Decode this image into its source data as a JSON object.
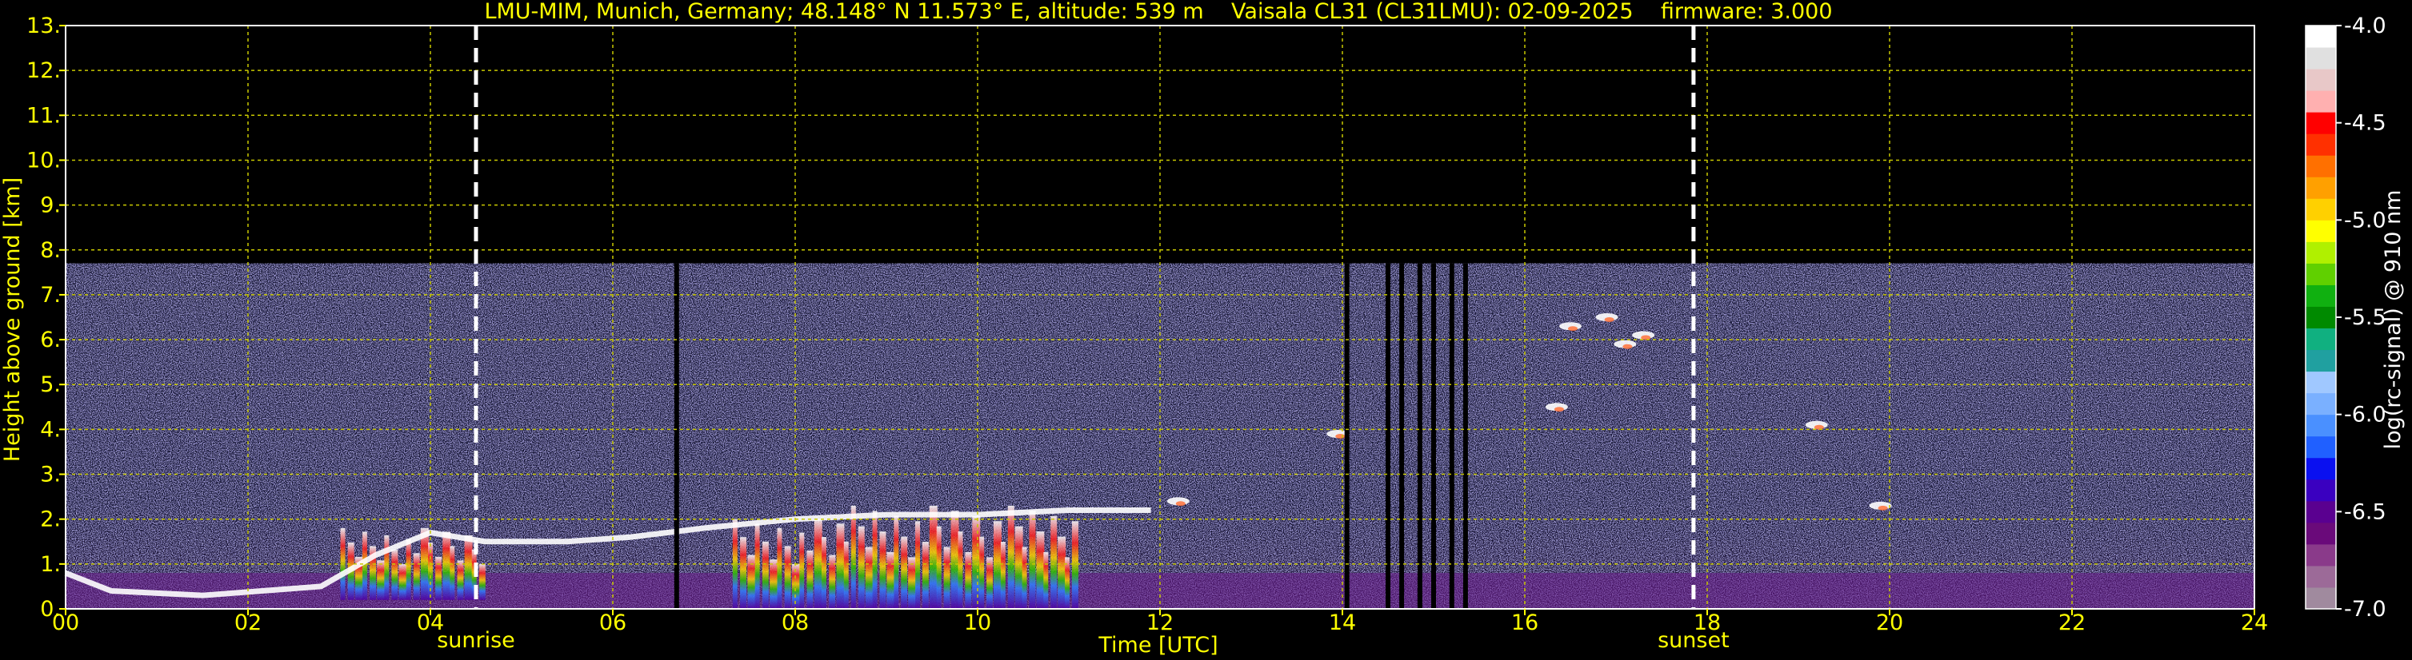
{
  "chart_data": {
    "type": "heatmap",
    "title": "LMU-MIM, Munich, Germany; 48.148° N 11.573° E, altitude: 539 m    Vaisala CL31 (CL31LMU): 02-09-2025    firmware: 3.000",
    "xlabel": "Time [UTC]",
    "ylabel": "Height above ground [km]",
    "xlim": [
      0,
      24
    ],
    "ylim": [
      0,
      13
    ],
    "x_ticks": [
      "00",
      "02",
      "04",
      "06",
      "08",
      "10",
      "12",
      "14",
      "16",
      "18",
      "20",
      "22",
      "24"
    ],
    "y_ticks": [
      "0.",
      "1.",
      "2.",
      "3.",
      "4.",
      "5.",
      "6.",
      "7.",
      "8.",
      "9.",
      "10.",
      "11.",
      "12.",
      "13."
    ],
    "grid": true,
    "grid_color": "#c8c800",
    "colorbar": {
      "label": "log(rc-signal) @ 910 nm",
      "range": [
        -7.0,
        -4.0
      ],
      "ticks": [
        "-7.0",
        "-6.5",
        "-6.0",
        "-5.5",
        "-5.0",
        "-4.5",
        "-4.0"
      ],
      "colors": [
        "#a08a9e",
        "#9c6a98",
        "#8a3a8a",
        "#6a0a7a",
        "#5a0090",
        "#3a00c0",
        "#0a10f0",
        "#2060ff",
        "#4a90ff",
        "#7ab0ff",
        "#a0c8ff",
        "#20a0a0",
        "#10b080",
        "#008a00",
        "#10b010",
        "#60d000",
        "#b0f000",
        "#ffff00",
        "#ffd000",
        "#ffa000",
        "#ff7000",
        "#ff3000",
        "#ff0000",
        "#ffb0b0",
        "#e8c8c8",
        "#e0e0e0",
        "#ffffff"
      ]
    },
    "annotations": [
      {
        "label": "sunrise",
        "x": 4.5
      },
      {
        "label": "sunset",
        "x": 17.85
      }
    ],
    "signal_top_km": 7.7,
    "cloud_layer": [
      {
        "x": 0.0,
        "y": 0.8
      },
      {
        "x": 0.5,
        "y": 0.4
      },
      {
        "x": 1.5,
        "y": 0.3
      },
      {
        "x": 2.8,
        "y": 0.5
      },
      {
        "x": 3.4,
        "y": 1.2
      },
      {
        "x": 4.0,
        "y": 1.7
      },
      {
        "x": 4.6,
        "y": 1.5
      },
      {
        "x": 5.5,
        "y": 1.5
      },
      {
        "x": 6.2,
        "y": 1.6
      },
      {
        "x": 7.0,
        "y": 1.8
      },
      {
        "x": 8.0,
        "y": 2.0
      },
      {
        "x": 9.0,
        "y": 2.1
      },
      {
        "x": 10.0,
        "y": 2.1
      },
      {
        "x": 11.0,
        "y": 2.2
      },
      {
        "x": 11.9,
        "y": 2.2
      }
    ],
    "aerosol_bursts": [
      {
        "x0": 3.0,
        "x1": 4.6,
        "y0": 0.2,
        "y1": 1.8
      },
      {
        "x0": 7.3,
        "x1": 8.6,
        "y0": 0.0,
        "y1": 2.0
      },
      {
        "x0": 8.6,
        "x1": 11.1,
        "y0": 0.0,
        "y1": 2.3
      }
    ],
    "clouds_high": [
      {
        "x": 13.95,
        "y": 3.9
      },
      {
        "x": 16.35,
        "y": 4.5
      },
      {
        "x": 16.5,
        "y": 6.3
      },
      {
        "x": 16.9,
        "y": 6.5
      },
      {
        "x": 17.1,
        "y": 5.9
      },
      {
        "x": 17.3,
        "y": 6.1
      },
      {
        "x": 19.2,
        "y": 4.1
      },
      {
        "x": 19.9,
        "y": 2.3
      },
      {
        "x": 12.2,
        "y": 2.4
      }
    ],
    "gap_columns": [
      6.7,
      14.05,
      14.5,
      14.65,
      14.85,
      15.0,
      15.2,
      15.35
    ]
  }
}
